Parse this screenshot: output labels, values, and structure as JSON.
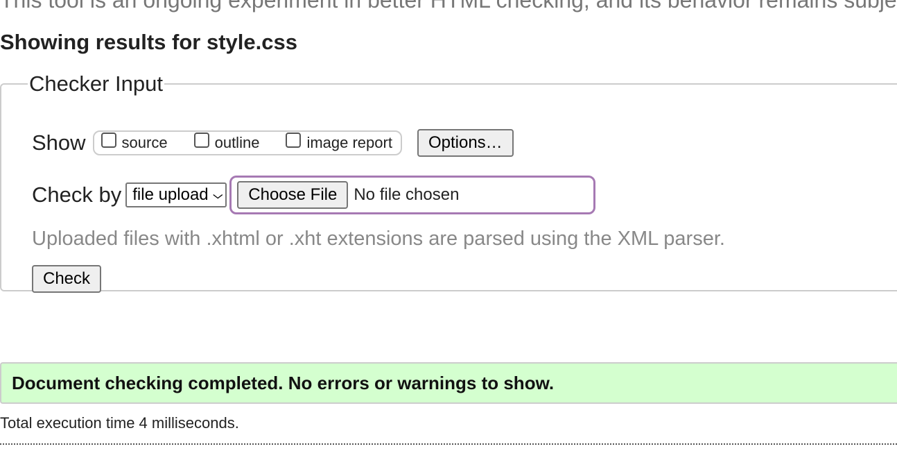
{
  "intro": {
    "text": "This tool is an ongoing experiment in better HTML checking, and its behavior remains subje"
  },
  "results": {
    "heading": "Showing results for style.css"
  },
  "checker": {
    "legend": "Checker Input",
    "show_label": "Show",
    "show_options": [
      {
        "label": "source",
        "checked": false
      },
      {
        "label": "outline",
        "checked": false
      },
      {
        "label": "image report",
        "checked": false
      }
    ],
    "options_button": "Options…",
    "check_by_label": "Check by",
    "check_by_value": "file upload",
    "choose_file_button": "Choose File",
    "file_status": "No file chosen",
    "upload_note": "Uploaded files with .xhtml or .xht extensions are parsed using the XML parser.",
    "check_button": "Check"
  },
  "outcome": {
    "message": "Document checking completed. No errors or warnings to show.",
    "execution_time": "Total execution time 4 milliseconds."
  },
  "colors": {
    "success_background": "#d4ffcf",
    "focus_ring": "#a679b3",
    "hint_text": "#888888"
  },
  "icons": {
    "select_arrow": "chevron-down-icon"
  }
}
